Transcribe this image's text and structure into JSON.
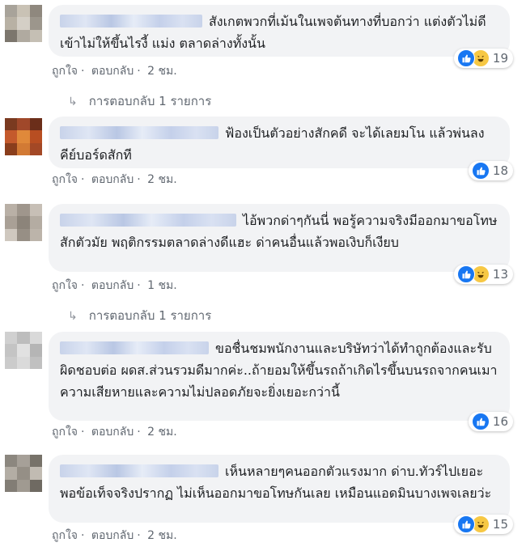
{
  "comments": [
    {
      "text": "สังเกตพวกที่เม้นในเพจต้นทางที่บอกว่า แต่งตัวไม่ดีเข้าไม่ให้ขึ้นไรงี้ แม่ง ตลาดล่างทั้งนั้น",
      "reaction_count": "19",
      "reactions": [
        "like",
        "haha"
      ],
      "like": "ถูกใจ",
      "reply": "ตอบกลับ",
      "time": "2 ชม.",
      "reply_count_label": "การตอบกลับ 1 รายการ"
    },
    {
      "text": "ฟ้องเป็นตัวอย่างสักคดี จะได้เลยมโน แล้วพ่นลงคีย์บอร์ดสักที",
      "reaction_count": "18",
      "reactions": [
        "like"
      ],
      "like": "ถูกใจ",
      "reply": "ตอบกลับ",
      "time": "2 ชม."
    },
    {
      "text": "ไอ้พวกด่าๆกันนี่ พอรู้ความจริงมีออกมาขอโทษสักตัวมัย พฤติกรรมตลาดล่างดีแฮะ ด่าคนอื่นแล้วพอเงิบก็เงียบ",
      "reaction_count": "13",
      "reactions": [
        "like",
        "haha"
      ],
      "like": "ถูกใจ",
      "reply": "ตอบกลับ",
      "time": "1 ชม.",
      "reply_count_label": "การตอบกลับ 1 รายการ"
    },
    {
      "text": "ขอชื่นชมพนักงานและบริษัทว่าได้ทำถูกต้องและรับผิดชอบต่อ ผดส.ส่วนรวมดีมากค่ะ..ถ้ายอมให้ขึ้นรถถ้าเกิดไรขึ้นบนรถจากคนเมาความเสียหายและความไม่ปลอดภัยจะยิ่งเยอะกว่านี้",
      "reaction_count": "16",
      "reactions": [
        "like"
      ],
      "like": "ถูกใจ",
      "reply": "ตอบกลับ",
      "time": "2 ชม."
    },
    {
      "text": "เห็นหลายๆคนออกตัวแรงมาก ด่าบ.ทัวร์ไปเยอะ พอข้อเท็จจริงปรากฏ ไม่เห็นออกมาขอโทษกันเลย เหมือนแอดมินบางเพจเลยว่ะ",
      "reaction_count": "15",
      "reactions": [
        "like",
        "haha"
      ],
      "like": "ถูกใจ",
      "reply": "ตอบกลับ",
      "time": "2 ชม."
    }
  ],
  "colors": {
    "like": "#1877f2",
    "haha": "#f7c844",
    "bubble": "#f2f3f5",
    "meta": "#606770"
  },
  "icons": {
    "like": "thumbs-up-icon",
    "haha": "laughing-face-icon",
    "reply_arrow": "reply-arrow-icon"
  }
}
